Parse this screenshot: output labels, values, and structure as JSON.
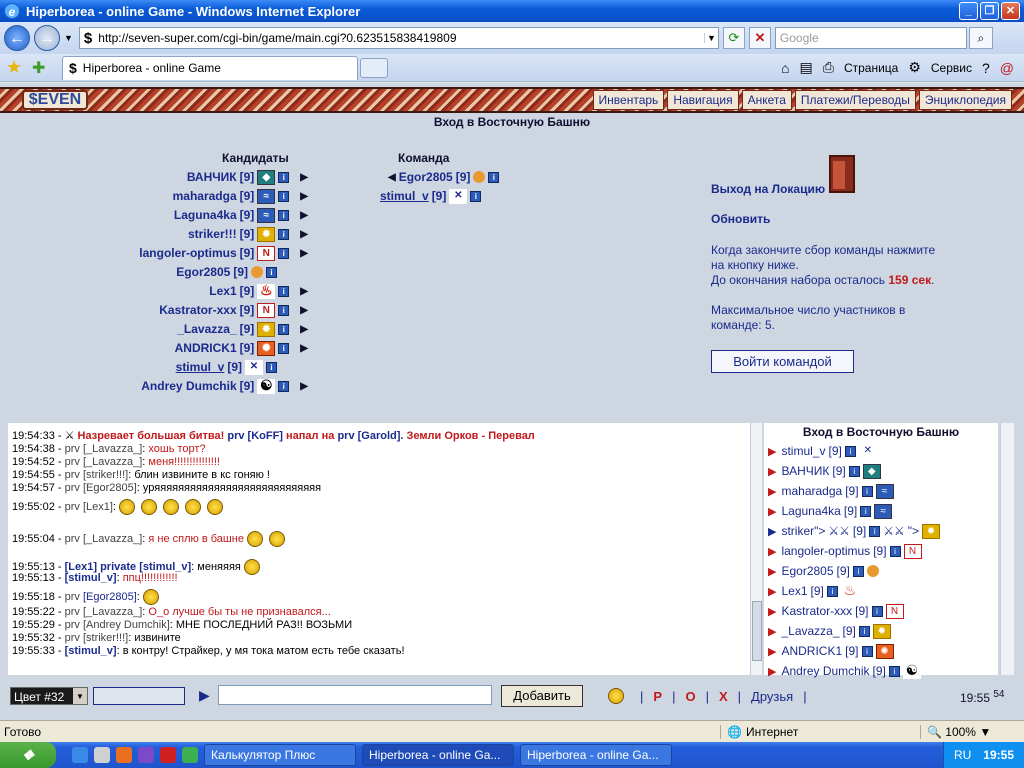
{
  "window": {
    "title": "Hiperborea - online Game - Windows Internet Explorer"
  },
  "browser": {
    "url": "http://seven-super.com/cgi-bin/game/main.cgi?0.623515838419809",
    "search_placeholder": "Google",
    "tab_title": "Hiperborea - online Game",
    "page_menu": "Страница",
    "tools_menu": "Сервис"
  },
  "game": {
    "logo": "$EVEN",
    "nav": [
      "Инвентарь",
      "Навигация",
      "Анкета",
      "Платежи/Переводы",
      "Энциклопедия"
    ],
    "title": "Вход в Восточную Башню",
    "candidates_header": "Кандидаты",
    "team_header": "Команда",
    "candidates": [
      {
        "name": "ВАНЧИК",
        "level": "[9]"
      },
      {
        "name": "maharadga",
        "level": "[9]"
      },
      {
        "name": "Laguna4ka",
        "level": "[9]"
      },
      {
        "name": "striker!!!",
        "level": "[9]"
      },
      {
        "name": "langoler-optimus",
        "level": "[9]"
      },
      {
        "name": "Egor2805",
        "level": "[9]"
      },
      {
        "name": "Lex1",
        "level": "[9]"
      },
      {
        "name": "Kastrator-xxx",
        "level": "[9]"
      },
      {
        "name": "_Lavazza_",
        "level": "[9]"
      },
      {
        "name": "ANDRICK1",
        "level": "[9]"
      },
      {
        "name": "stimul_v",
        "level": "[9]"
      },
      {
        "name": "Andrey Dumchik",
        "level": "[9]"
      }
    ],
    "team": [
      {
        "name": "Egor2805",
        "level": "[9]"
      },
      {
        "name": "stimul_v",
        "level": "[9]"
      }
    ],
    "exit_link": "Выход на Локацию",
    "refresh_link": "Обновить",
    "info_text_1": "Когда закончите сбор команды нажмите",
    "info_text_2": "на кнопку ниже.",
    "info_text_3": "До окончания набора осталось",
    "seconds_left": "159 сек",
    "info_text_4": "Максимальное число участников в",
    "info_text_5": "команде: 5.",
    "join_button": "Войти командой"
  },
  "chat": {
    "lines": [
      {
        "time": "19:54:33 -",
        "p1": "Назревает большая битва!",
        "p2": "prv [KoFF]",
        "p3": "напал на",
        "p4": "prv [Garold].",
        "p5": "Земли Орков - Перевал"
      },
      {
        "time": "19:54:38 -",
        "prefix": "prv",
        "nick": "[_Lavazza_]",
        "msg": "хошь торт?"
      },
      {
        "time": "19:54:52 -",
        "prefix": "prv",
        "nick": "[_Lavazza_]",
        "msg": "меня!!!!!!!!!!!!!!!"
      },
      {
        "time": "19:54:55 -",
        "prefix": "prv",
        "nick": "[striker!!!]",
        "msg": "блин извините в кс гоняю !"
      },
      {
        "time": "19:54:57 -",
        "prefix": "prv",
        "nick": "[Egor2805]",
        "msg": "уряяяяяяяяяяяяяяяяяяяяяяяяяяяя"
      },
      {
        "time": "19:55:02 -",
        "prefix": "prv",
        "nick": "[Lex1]",
        "msg": ""
      },
      {
        "time": "19:55:04 -",
        "prefix": "prv",
        "nick": "[_Lavazza_]",
        "msg": "я не сплю в башне"
      },
      {
        "time": "19:55:13 -",
        "prefix": "[Lex1] private [stimul_v]",
        "nick": "",
        "msg": "меняяяя"
      },
      {
        "time": "19:55:13 -",
        "prefix": "[stimul_v]",
        "nick": "",
        "msg": "ппц!!!!!!!!!!!!"
      },
      {
        "time": "19:55:18 -",
        "prefix": "prv",
        "nick": "[Egor2805]",
        "msg": ""
      },
      {
        "time": "19:55:22 -",
        "prefix": "prv",
        "nick": "[_Lavazza_]",
        "msg": "О_о лучше бы ты не признавался..."
      },
      {
        "time": "19:55:29 -",
        "prefix": "prv",
        "nick": "[Andrey Dumchik]",
        "msg": "МНЕ ПОСЛЕДНИЙ РАЗ!! ВОЗЬМИ"
      },
      {
        "time": "19:55:32 -",
        "prefix": "prv",
        "nick": "[striker!!!]",
        "msg": "извините"
      },
      {
        "time": "19:55:33 -",
        "prefix": "[stimul_v]",
        "nick": "",
        "msg": "в контру! Страйкер, у мя тока матом есть тебе сказать!"
      }
    ]
  },
  "userlist": {
    "title": "Вход в Восточную Башню",
    "users": [
      {
        "name": "stimul_v",
        "level": "[9]"
      },
      {
        "name": "ВАНЧИК",
        "level": "[9]"
      },
      {
        "name": "maharadga",
        "level": "[9]"
      },
      {
        "name": "Laguna4ka",
        "level": "[9]"
      },
      {
        "name": "striker\">",
        "level": "[9]"
      },
      {
        "name": "langoler-optimus",
        "level": "[9]"
      },
      {
        "name": "Egor2805",
        "level": "[9]"
      },
      {
        "name": "Lex1",
        "level": "[9]"
      },
      {
        "name": "Kastrator-xxx",
        "level": "[9]"
      },
      {
        "name": "_Lavazza_",
        "level": "[9]"
      },
      {
        "name": "ANDRICK1",
        "level": "[9]"
      },
      {
        "name": "Andrey Dumchik",
        "level": "[9]"
      }
    ],
    "striker_tail": "\">"
  },
  "bottombar": {
    "color_select": "Цвет #32",
    "add_button": "Добавить",
    "link_p": "P",
    "link_o": "O",
    "link_x": "X",
    "link_friends": "Друзья",
    "clock": "19:55",
    "clock_sec": "54"
  },
  "statusbar": {
    "ready": "Готово",
    "zone": "Интернет",
    "zoom": "100%"
  },
  "taskbar": {
    "tasks": [
      "Калькулятор Плюс",
      "Hiperborea - online Ga...",
      "Hiperborea - online Ga..."
    ],
    "lang": "RU",
    "time": "19:55"
  },
  "colors": {
    "accent": "#1a2b8c",
    "alert": "#c01a1a"
  }
}
